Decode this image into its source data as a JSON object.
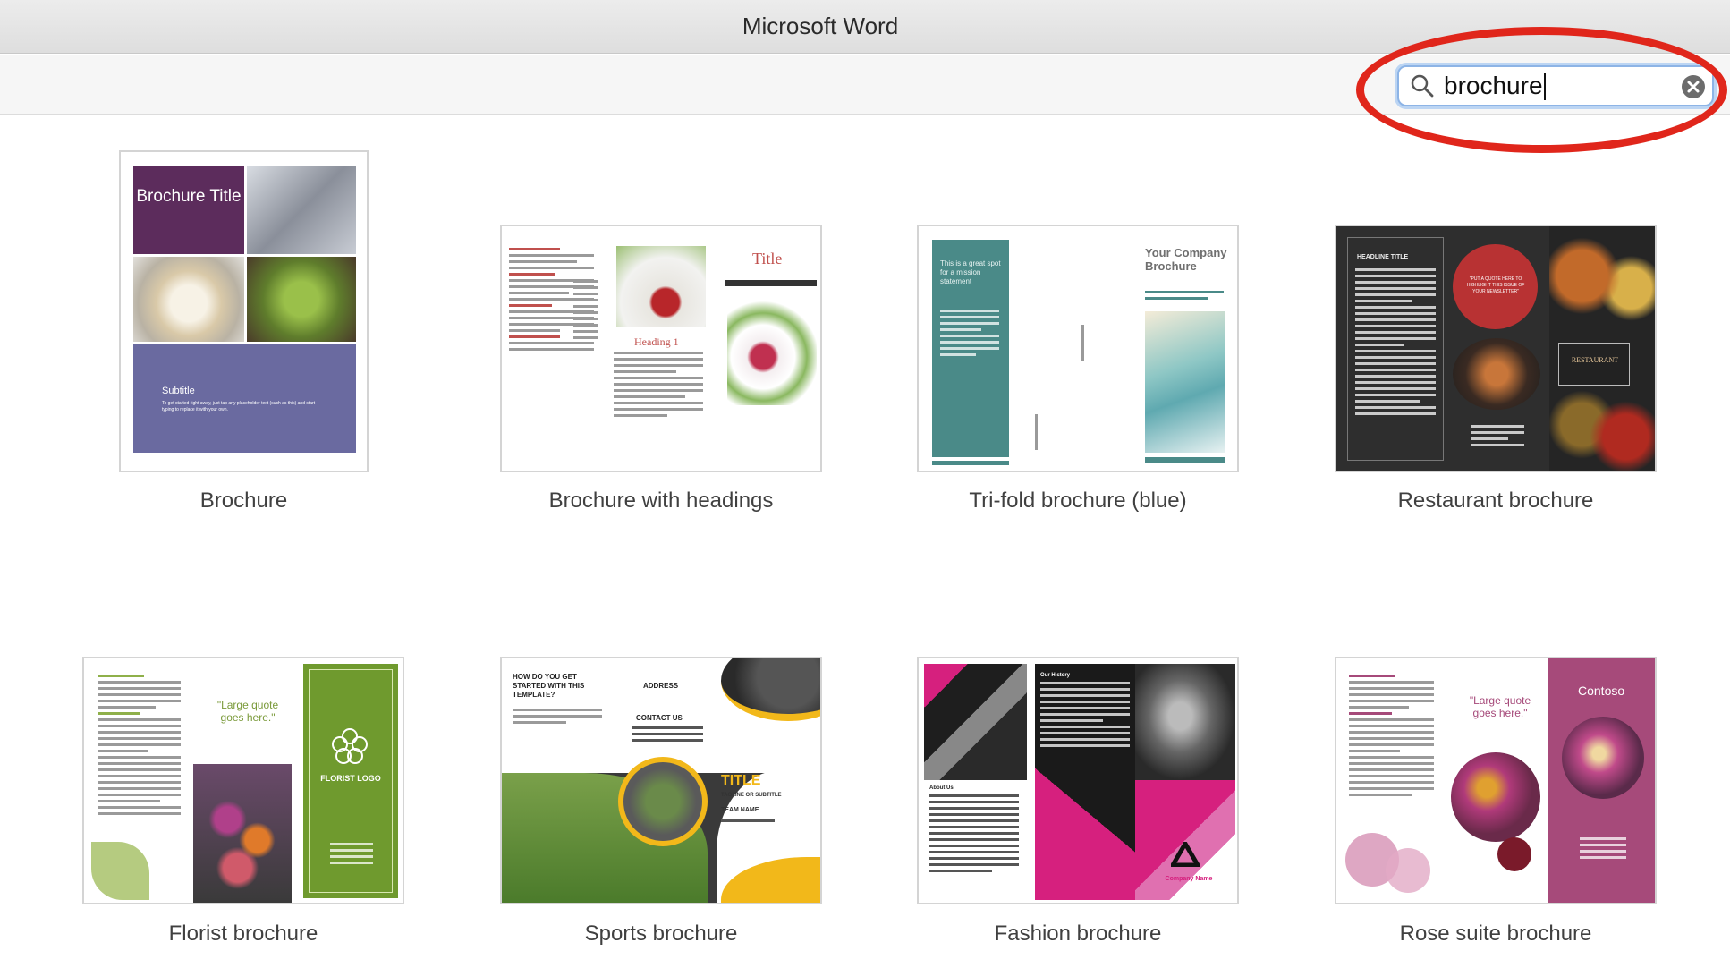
{
  "window": {
    "title": "Microsoft Word"
  },
  "search": {
    "value": "brochure",
    "clear_icon": "clear-icon",
    "search_icon": "magnifier-icon"
  },
  "annotation": {
    "color": "#e0261b"
  },
  "templates": [
    {
      "label": "Brochure",
      "thumb": {
        "title": "Brochure Title",
        "subtitle": "Subtitle",
        "body": "To get started right away, just tap any placeholder text (such as this) and start typing to replace it with your own."
      }
    },
    {
      "label": "Brochure with headings",
      "thumb": {
        "heading": "Heading 1",
        "title": "Title",
        "heading_small": "HEADING 2"
      }
    },
    {
      "label": "Tri-fold brochure (blue)",
      "thumb": {
        "statement": "This is a great spot for a mission statement",
        "company": "Your Company Brochure"
      }
    },
    {
      "label": "Restaurant brochure",
      "thumb": {
        "headline": "HEADLINE TITLE",
        "quote": "\"PUT A QUOTE HERE TO HIGHLIGHT THIS ISSUE OF YOUR NEWSLETTER\"",
        "badge": "RESTAURANT"
      }
    },
    {
      "label": "Florist brochure",
      "thumb": {
        "quote": "\"Large quote goes here.\"",
        "logo": "FLORIST LOGO"
      }
    },
    {
      "label": "Sports brochure",
      "thumb": {
        "question": "HOW DO YOU GET STARTED WITH THIS TEMPLATE?",
        "address": "ADDRESS",
        "contact": "CONTACT US",
        "title": "TITLE",
        "tagline": "TAGLINE OR SUBTITLE",
        "team": "TEAM NAME"
      }
    },
    {
      "label": "Fashion brochure",
      "thumb": {
        "history": "Our History",
        "about": "About Us",
        "company": "Company Name"
      }
    },
    {
      "label": "Rose suite brochure",
      "thumb": {
        "quote": "\"Large quote goes here.\"",
        "brand": "Contoso"
      }
    }
  ]
}
